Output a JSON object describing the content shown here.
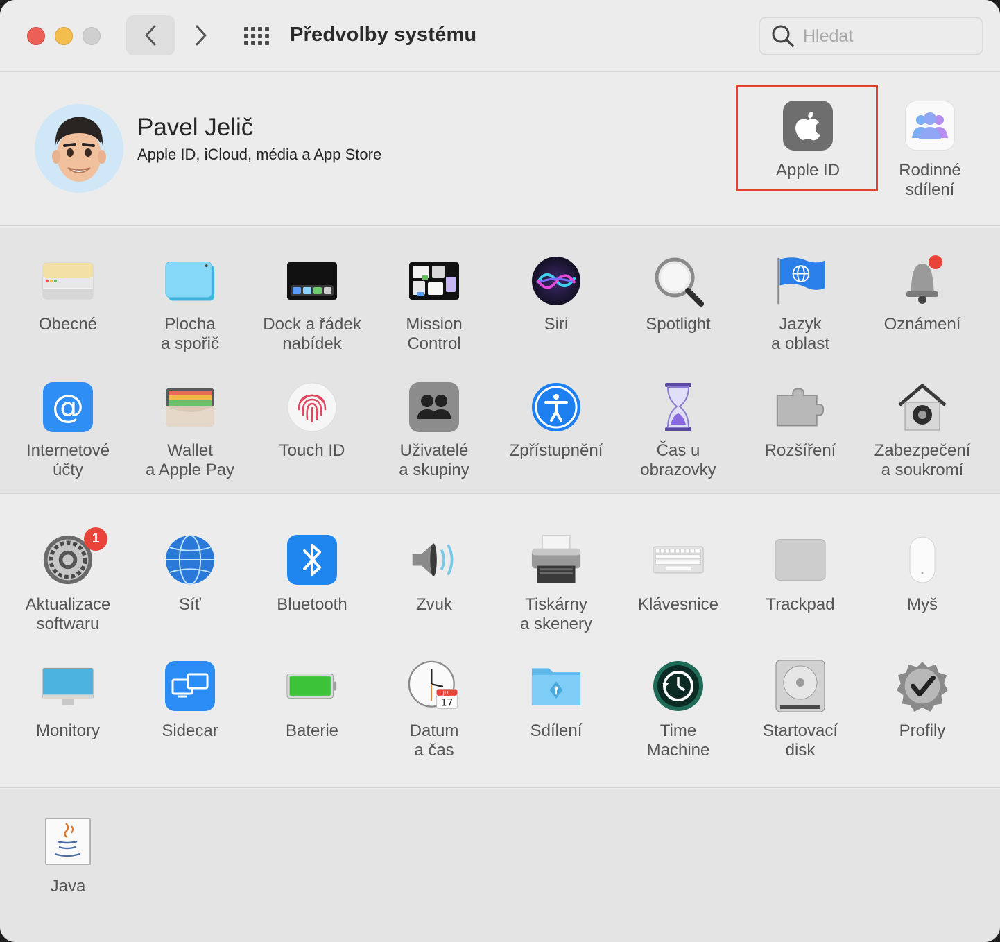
{
  "window": {
    "title": "Předvolby systému"
  },
  "search": {
    "placeholder": "Hledat"
  },
  "account": {
    "name": "Pavel Jelič",
    "subtitle": "Apple ID, iCloud, média a App Store",
    "apple_id_label": "Apple ID",
    "family_label": "Rodinné\nsdílení"
  },
  "panes_row1": [
    {
      "label": "Obecné",
      "icon": "general-icon"
    },
    {
      "label": "Plocha\na spořič",
      "icon": "desktop-icon"
    },
    {
      "label": "Dock a řádek\nnabídek",
      "icon": "dock-icon"
    },
    {
      "label": "Mission\nControl",
      "icon": "mission-control-icon"
    },
    {
      "label": "Siri",
      "icon": "siri-icon"
    },
    {
      "label": "Spotlight",
      "icon": "spotlight-icon"
    },
    {
      "label": "Jazyk\na oblast",
      "icon": "language-flag-icon"
    },
    {
      "label": "Oznámení",
      "icon": "notification-bell-icon"
    }
  ],
  "panes_row2": [
    {
      "label": "Internetové\núčty",
      "icon": "at-sign-icon"
    },
    {
      "label": "Wallet\na Apple Pay",
      "icon": "wallet-icon"
    },
    {
      "label": "Touch ID",
      "icon": "fingerprint-icon"
    },
    {
      "label": "Uživatelé\na skupiny",
      "icon": "users-icon"
    },
    {
      "label": "Zpřístupnění",
      "icon": "accessibility-icon"
    },
    {
      "label": "Čas u obrazovky",
      "icon": "hourglass-icon"
    },
    {
      "label": "Rozšíření",
      "icon": "puzzle-icon"
    },
    {
      "label": "Zabezpečení\na soukromí",
      "icon": "security-house-icon"
    }
  ],
  "panes_row3": [
    {
      "label": "Aktualizace\nsoftwaru",
      "icon": "software-update-gear-icon",
      "badge": "1"
    },
    {
      "label": "Síť",
      "icon": "network-globe-icon"
    },
    {
      "label": "Bluetooth",
      "icon": "bluetooth-icon"
    },
    {
      "label": "Zvuk",
      "icon": "speaker-icon"
    },
    {
      "label": "Tiskárny\na skenery",
      "icon": "printer-icon"
    },
    {
      "label": "Klávesnice",
      "icon": "keyboard-icon"
    },
    {
      "label": "Trackpad",
      "icon": "trackpad-icon"
    },
    {
      "label": "Myš",
      "icon": "mouse-icon"
    }
  ],
  "panes_row4": [
    {
      "label": "Monitory",
      "icon": "monitor-icon"
    },
    {
      "label": "Sidecar",
      "icon": "sidecar-icon"
    },
    {
      "label": "Baterie",
      "icon": "battery-icon"
    },
    {
      "label": "Datum\na čas",
      "icon": "clock-calendar-icon",
      "calendar_month": "JUL",
      "calendar_day": "17"
    },
    {
      "label": "Sdílení",
      "icon": "sharing-folder-icon"
    },
    {
      "label": "Time\nMachine",
      "icon": "time-machine-icon"
    },
    {
      "label": "Startovací\ndisk",
      "icon": "startup-disk-icon"
    },
    {
      "label": "Profily",
      "icon": "profiles-checkmark-icon"
    }
  ],
  "panes_other": [
    {
      "label": "Java",
      "icon": "java-cup-icon"
    }
  ],
  "colors": {
    "highlight_box": "#e1412f",
    "badge": "#e8443a",
    "close": "#ec5f56",
    "minimize": "#f4be4f"
  }
}
